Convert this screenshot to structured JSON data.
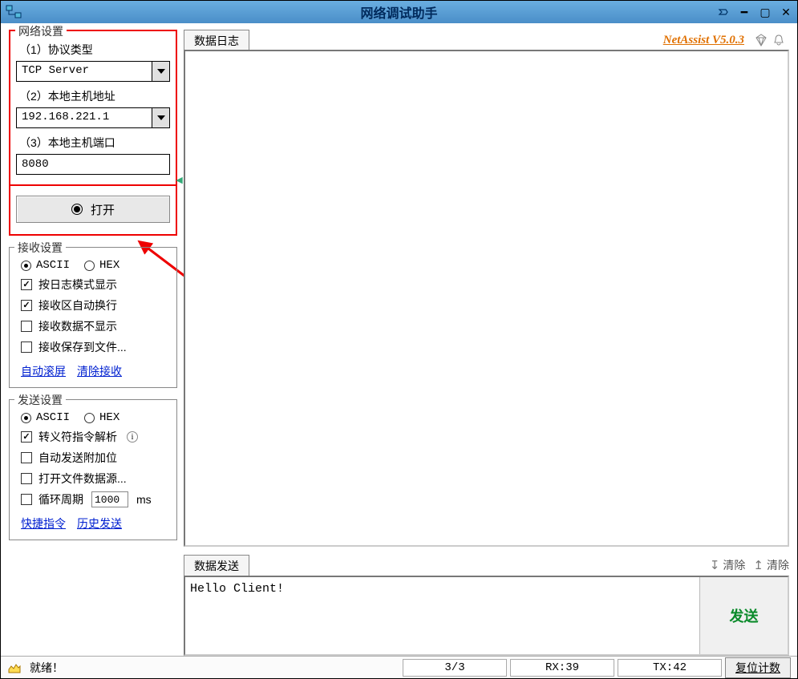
{
  "titlebar": {
    "title": "网络调试助手"
  },
  "network": {
    "legend": "网络设置",
    "protocol_label": "（1）协议类型",
    "protocol_value": "TCP Server",
    "host_label": "（2）本地主机地址",
    "host_value": "192.168.221.1",
    "port_label": "（3）本地主机端口",
    "port_value": "8080",
    "open_btn": "打开"
  },
  "recv": {
    "legend": "接收设置",
    "ascii": "ASCII",
    "hex": "HEX",
    "log_mode": "按日志模式显示",
    "auto_wrap": "接收区自动换行",
    "hide_recv": "接收数据不显示",
    "save_file": "接收保存到文件...",
    "auto_scroll": "自动滚屏",
    "clear_recv": "清除接收"
  },
  "send": {
    "legend": "发送设置",
    "ascii": "ASCII",
    "hex": "HEX",
    "escape": "转义符指令解析",
    "auto_append": "自动发送附加位",
    "open_file": "打开文件数据源...",
    "cycle_prefix": "循环周期",
    "cycle_value": "1000",
    "cycle_unit": "ms",
    "quick_cmd": "快捷指令",
    "history": "历史发送"
  },
  "main": {
    "log_tab": "数据日志",
    "brand": "NetAssist V5.0.3",
    "send_tab": "数据发送",
    "clear1": "清除",
    "clear2": "清除",
    "send_text": "Hello Client!",
    "send_btn": "发送"
  },
  "status": {
    "ready": "就绪！",
    "ratio": "3/3",
    "rx": "RX:39",
    "tx": "TX:42",
    "reset": "复位计数"
  }
}
